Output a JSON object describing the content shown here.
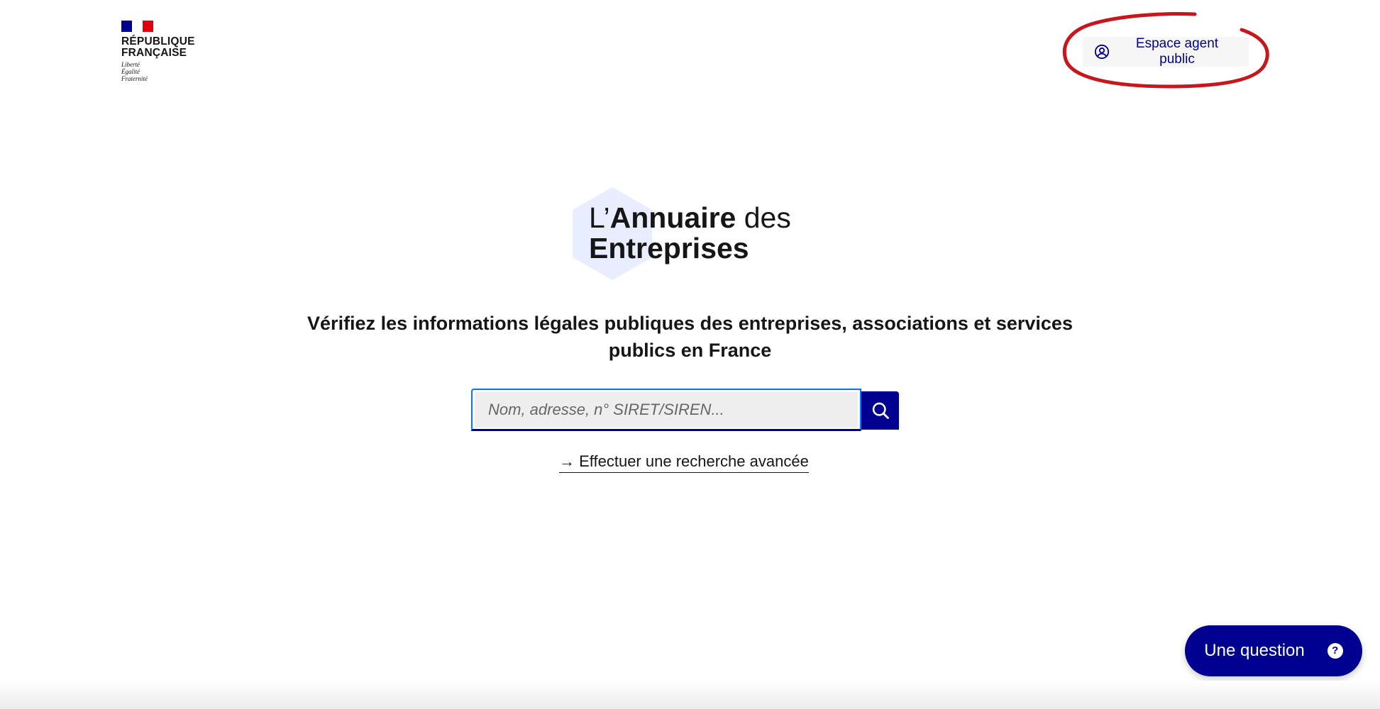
{
  "header": {
    "republic_line1": "RÉPUBLIQUE",
    "republic_line2": "FRANÇAISE",
    "motto": [
      "Liberté",
      "Égalité",
      "Fraternité"
    ],
    "agent_button_label": "Espace agent public"
  },
  "brand": {
    "prefix": "L’",
    "name_bold": "Annuaire",
    "suffix": " des",
    "line2": "Entreprises"
  },
  "main": {
    "tagline": "Vérifiez les informations légales publiques des entreprises, associations et services publics en France",
    "search_placeholder": "Nom, adresse, n° SIRET/SIREN...",
    "search_value": "",
    "advanced_search_label": "→ Effectuer une recherche avancée"
  },
  "help": {
    "question_label": "Une question",
    "question_icon_glyph": "?"
  },
  "colors": {
    "primary": "#000091",
    "flag_blue": "#000091",
    "flag_red": "#e1000f",
    "annotation": "#c8161d",
    "hexagon": "#e8edff"
  }
}
